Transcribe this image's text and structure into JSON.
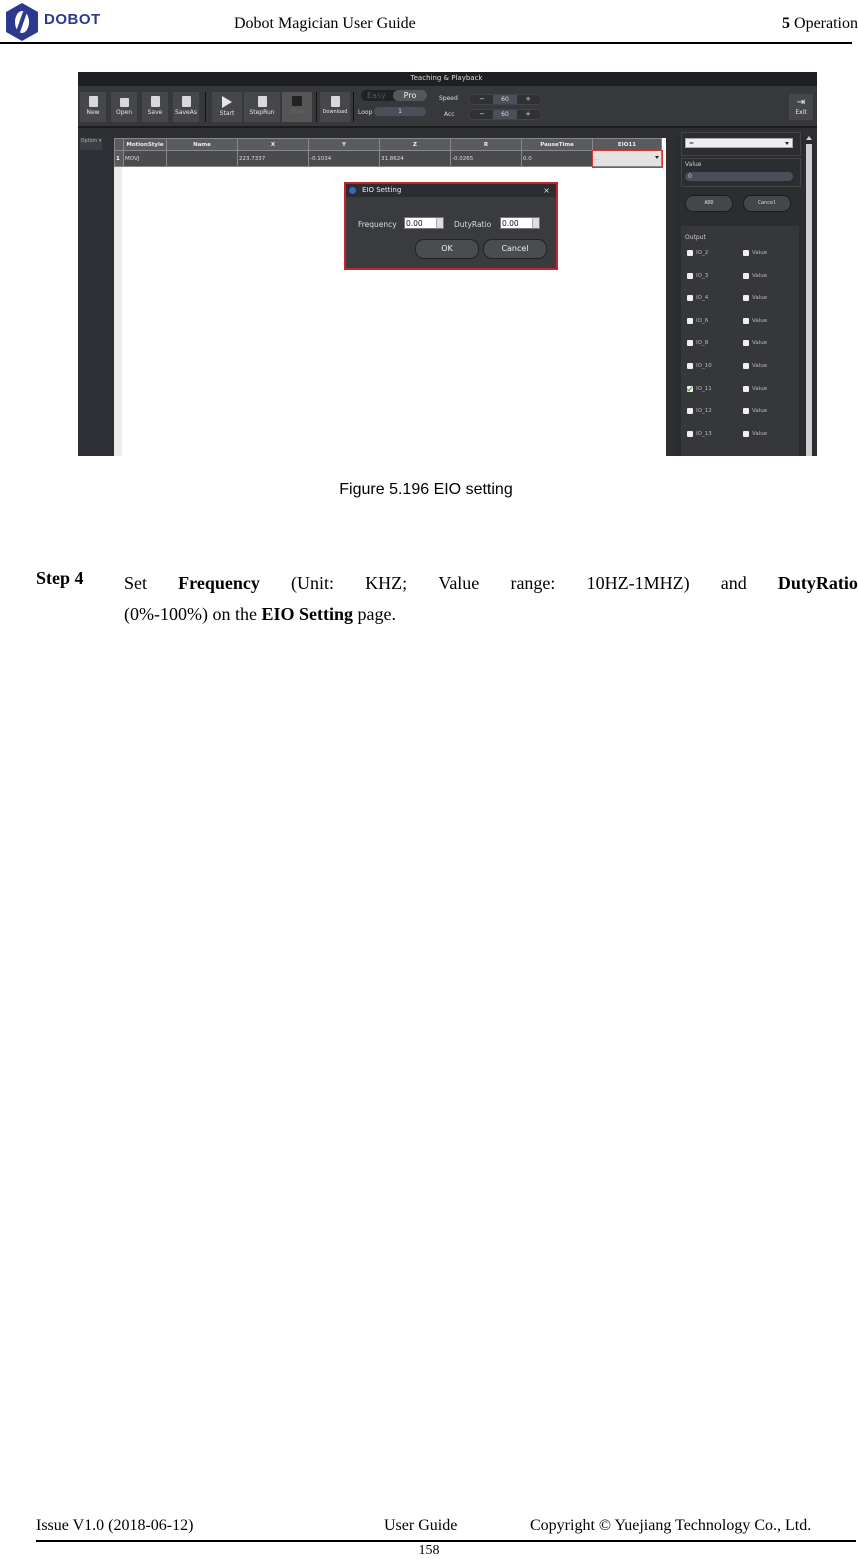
{
  "header": {
    "brand": "DOBOT",
    "title": "Dobot Magician User Guide",
    "section_num": "5",
    "section_name": " Operation"
  },
  "screenshot": {
    "window_title": "Teaching & Playback",
    "toolbar": {
      "new": "New",
      "open": "Open",
      "save": "Save",
      "saveas": "SaveAs",
      "start": "Start",
      "steprun": "StepRun",
      "stop": "Stop",
      "download": "Download",
      "mode_easy": "Easy",
      "mode_pro": "Pro",
      "loop_label": "Loop",
      "loop_value": "1",
      "speed_label": "Speed",
      "speed_value": "60",
      "acc_label": "Acc",
      "acc_value": "60",
      "minus": "−",
      "plus": "+",
      "exit": "Exit"
    },
    "option_button": "Option ▾",
    "table": {
      "columns": [
        "MotionStyle",
        "Name",
        "X",
        "Y",
        "Z",
        "R",
        "PauseTime",
        "EIO11"
      ],
      "rows": [
        {
          "num": "1",
          "cells": [
            "MOVJ",
            "",
            "223.7337",
            "-0.1034",
            "31.8624",
            "-0.0265",
            "0.0",
            "..."
          ]
        }
      ]
    },
    "dialog": {
      "title": "EIO Setting",
      "close": "×",
      "frequency_label": "Frequency",
      "frequency_value": "0.00",
      "dutyratio_label": "DutyRatio",
      "dutyratio_value": "0.00",
      "ok": "OK",
      "cancel": "Cancel"
    },
    "right_panel": {
      "combo_value": "=",
      "value_label": "Value",
      "value_input": "0",
      "add": "ADD",
      "cancel": "Cancel",
      "output_label": "Output",
      "outputs": [
        {
          "io": "IO_2",
          "checked": false,
          "value_label": "Value"
        },
        {
          "io": "IO_3",
          "checked": false,
          "value_label": "Value"
        },
        {
          "io": "IO_4",
          "checked": false,
          "value_label": "Value"
        },
        {
          "io": "IO_6",
          "checked": false,
          "value_label": "Value"
        },
        {
          "io": "IO_8",
          "checked": false,
          "value_label": "Value"
        },
        {
          "io": "IO_10",
          "checked": false,
          "value_label": "Value"
        },
        {
          "io": "IO_11",
          "checked": true,
          "value_label": "Value"
        },
        {
          "io": "IO_12",
          "checked": false,
          "value_label": "Value"
        },
        {
          "io": "IO_13",
          "checked": false,
          "value_label": "Value"
        }
      ]
    }
  },
  "caption": "Figure 5.196    EIO setting",
  "step": {
    "label": "Step 4",
    "t1": "Set",
    "b1": "Frequency",
    "t2": "(Unit:",
    "t3": "KHZ;",
    "t4": "Value",
    "t5": "range:",
    "t6": "10HZ-1MHZ)",
    "t7": "and",
    "b2": "DutyRatio",
    "t8": "(0%-100%) on the ",
    "b3": "EIO Setting",
    "t9": " page."
  },
  "footer": {
    "issue": "Issue V1.0 (2018-06-12)",
    "doc_type": "User Guide",
    "copyright": "Copyright © Yuejiang Technology Co., Ltd.",
    "page": "158"
  }
}
